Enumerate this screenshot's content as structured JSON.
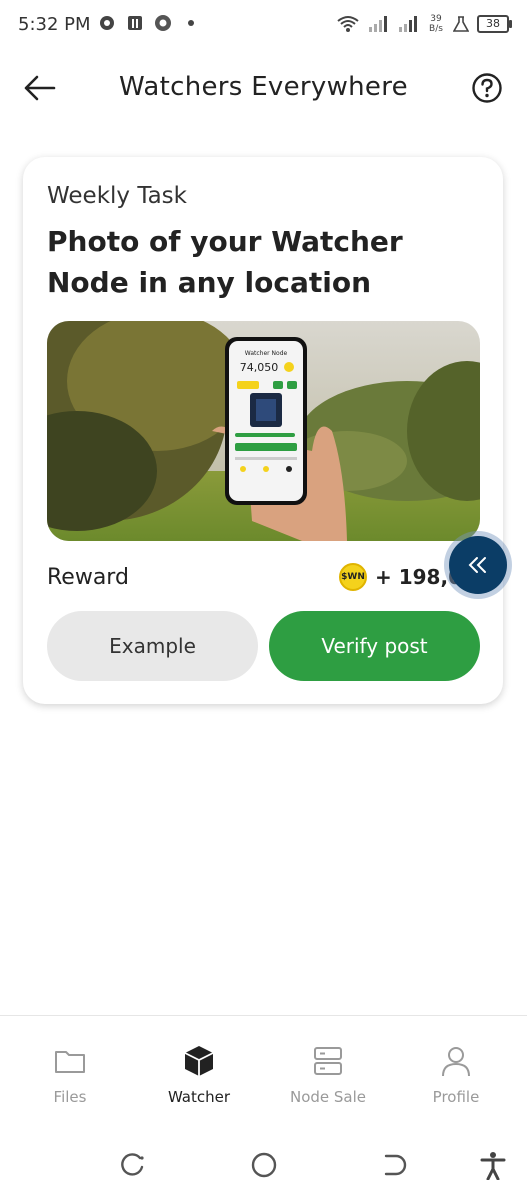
{
  "status_bar": {
    "time": "5:32 PM",
    "speed_value": "39",
    "speed_unit": "B/s",
    "battery": "38"
  },
  "header": {
    "title": "Watchers Everywhere",
    "back_icon": "arrow-left-icon",
    "help_icon": "question-circle-icon"
  },
  "task": {
    "kicker": "Weekly Task",
    "title": "Photo of your Watcher Node in any location",
    "reward_label": "Reward",
    "reward_coin": "$WN",
    "reward_amount": "+ 198,00",
    "example_label": "Example",
    "verify_label": "Verify post",
    "phone_screen": {
      "app_title": "Watcher Node",
      "balance": "74,050"
    }
  },
  "nav": {
    "items": [
      {
        "label": "Files",
        "icon": "folder-icon",
        "active": false
      },
      {
        "label": "Watcher",
        "icon": "cube-icon",
        "active": true
      },
      {
        "label": "Node Sale",
        "icon": "server-icon",
        "active": false
      },
      {
        "label": "Profile",
        "icon": "user-icon",
        "active": false
      }
    ]
  },
  "colors": {
    "accent_green": "#2e9e42",
    "float_button": "#0b3d66",
    "coin_yellow": "#f4d21c"
  }
}
